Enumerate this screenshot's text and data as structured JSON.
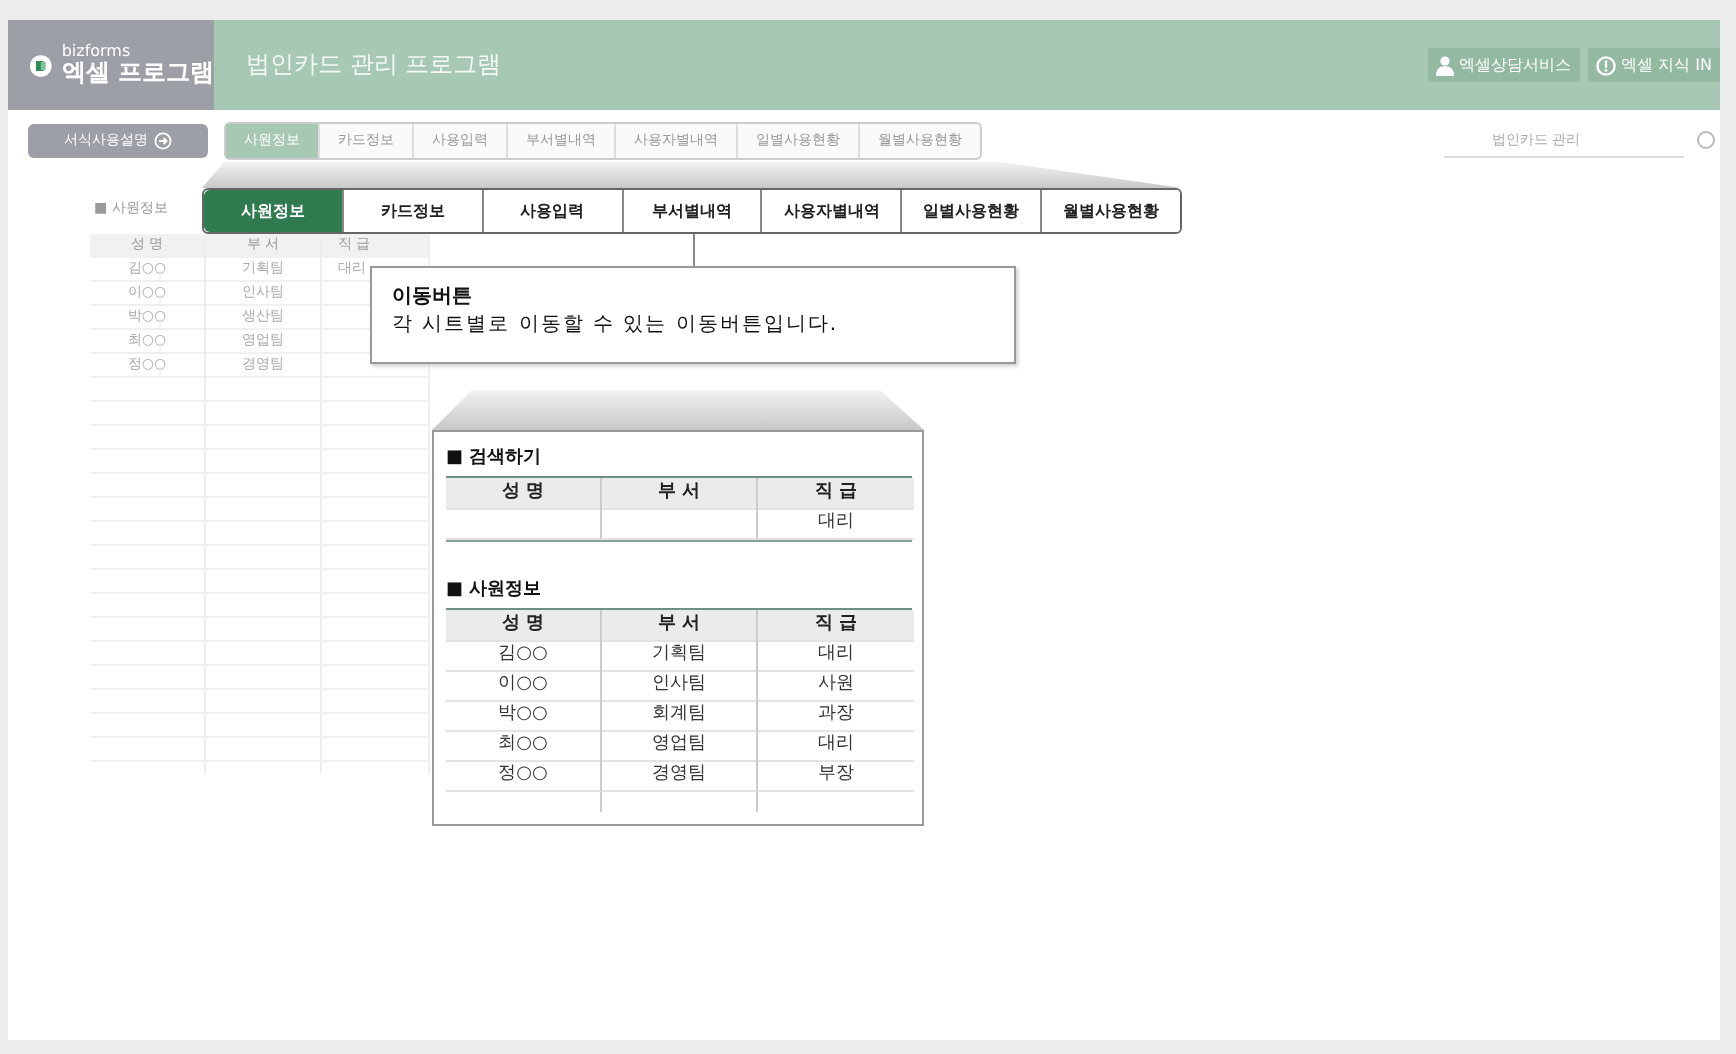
{
  "header": {
    "brand": "bizforms",
    "logo_title": "엑셀 프로그램",
    "title": "법인카드 관리 프로그램",
    "links": [
      {
        "label": "엑셀상담서비스",
        "kind": "person"
      },
      {
        "label": "엑셀 지식 IN",
        "kind": "info"
      }
    ]
  },
  "guide_button": {
    "label": "서식사용설명"
  },
  "tabs": [
    {
      "label": "사원정보",
      "selected": true
    },
    {
      "label": "카드정보",
      "selected": false
    },
    {
      "label": "사용입력",
      "selected": false
    },
    {
      "label": "부서별내역",
      "selected": false
    },
    {
      "label": "사용자별내역",
      "selected": false
    },
    {
      "label": "일별사용현황",
      "selected": false
    },
    {
      "label": "월별사용현황",
      "selected": false
    }
  ],
  "search": {
    "placeholder": "법인카드 관리"
  },
  "sheet": {
    "title": "■ 사원정보",
    "columns": [
      "성 명",
      "부 서",
      "직 급"
    ],
    "rows": [
      [
        "김○○",
        "기획팀",
        "대리"
      ],
      [
        "이○○",
        "인사팀",
        null
      ],
      [
        "박○○",
        "생산팀",
        null
      ],
      [
        "최○○",
        "영업팀",
        null
      ],
      [
        "정○○",
        "경영팀",
        null
      ]
    ]
  },
  "zoom_tabs": [
    {
      "label": "사원정보",
      "selected": true
    },
    {
      "label": "카드정보",
      "selected": false
    },
    {
      "label": "사용입력",
      "selected": false
    },
    {
      "label": "부서별내역",
      "selected": false
    },
    {
      "label": "사용자별내역",
      "selected": false
    },
    {
      "label": "일별사용현황",
      "selected": false
    },
    {
      "label": "월별사용현황",
      "selected": false
    }
  ],
  "callout": {
    "title": "이동버튼",
    "text": "각 시트별로 이동할 수 있는 이동버튼입니다."
  },
  "zoom_panel": {
    "search_title": "■ 검색하기",
    "search_columns": [
      "성 명",
      "부 서",
      "직 급"
    ],
    "search_rows": [
      [
        null,
        null,
        "대리"
      ]
    ],
    "staff_title": "■ 사원정보",
    "staff_columns": [
      "성 명",
      "부 서",
      "직 급"
    ],
    "staff_rows": [
      [
        "김○○",
        "기획팀",
        "대리"
      ],
      [
        "이○○",
        "인사팀",
        "사원"
      ],
      [
        "박○○",
        "회계팀",
        "과장"
      ],
      [
        "최○○",
        "영업팀",
        "대리"
      ],
      [
        "정○○",
        "경영팀",
        "부장"
      ]
    ]
  }
}
